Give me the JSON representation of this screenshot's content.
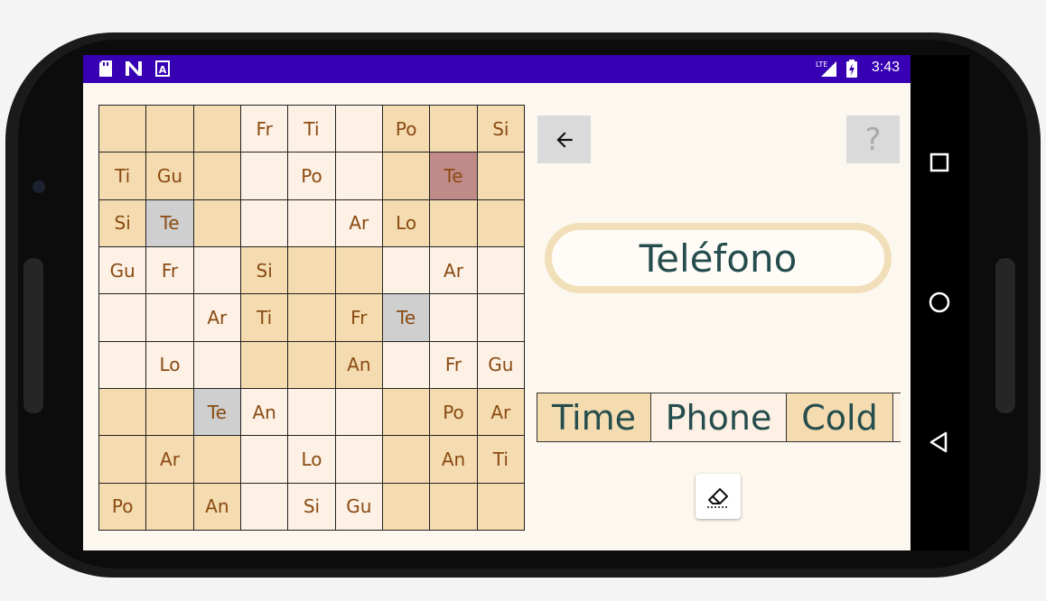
{
  "status_bar": {
    "time": "3:43",
    "network_label": "LTE",
    "left_icons": [
      "sd-card-icon",
      "n-icon",
      "a-icon"
    ],
    "bg_color": "#3700b3"
  },
  "grid": {
    "rows": [
      [
        {
          "t": "",
          "s": "dark"
        },
        {
          "t": "",
          "s": "dark"
        },
        {
          "t": "",
          "s": "dark"
        },
        {
          "t": "Fr",
          "s": "light"
        },
        {
          "t": "Ti",
          "s": "light"
        },
        {
          "t": "",
          "s": "light"
        },
        {
          "t": "Po",
          "s": "dark"
        },
        {
          "t": "",
          "s": "dark"
        },
        {
          "t": "Si",
          "s": "dark"
        }
      ],
      [
        {
          "t": "Ti",
          "s": "dark"
        },
        {
          "t": "Gu",
          "s": "dark"
        },
        {
          "t": "",
          "s": "dark"
        },
        {
          "t": "",
          "s": "light"
        },
        {
          "t": "Po",
          "s": "light"
        },
        {
          "t": "",
          "s": "light"
        },
        {
          "t": "",
          "s": "dark"
        },
        {
          "t": "Te",
          "s": "highlight"
        },
        {
          "t": "",
          "s": "dark"
        }
      ],
      [
        {
          "t": "Si",
          "s": "dark"
        },
        {
          "t": "Te",
          "s": "selected"
        },
        {
          "t": "",
          "s": "dark"
        },
        {
          "t": "",
          "s": "light"
        },
        {
          "t": "",
          "s": "light"
        },
        {
          "t": "Ar",
          "s": "light"
        },
        {
          "t": "Lo",
          "s": "dark"
        },
        {
          "t": "",
          "s": "dark"
        },
        {
          "t": "",
          "s": "dark"
        }
      ],
      [
        {
          "t": "Gu",
          "s": "light"
        },
        {
          "t": "Fr",
          "s": "light"
        },
        {
          "t": "",
          "s": "light"
        },
        {
          "t": "Si",
          "s": "dark"
        },
        {
          "t": "",
          "s": "dark"
        },
        {
          "t": "",
          "s": "dark"
        },
        {
          "t": "",
          "s": "light"
        },
        {
          "t": "Ar",
          "s": "light"
        },
        {
          "t": "",
          "s": "light"
        }
      ],
      [
        {
          "t": "",
          "s": "light"
        },
        {
          "t": "",
          "s": "light"
        },
        {
          "t": "Ar",
          "s": "light"
        },
        {
          "t": "Ti",
          "s": "dark"
        },
        {
          "t": "",
          "s": "dark"
        },
        {
          "t": "Fr",
          "s": "dark"
        },
        {
          "t": "Te",
          "s": "selected"
        },
        {
          "t": "",
          "s": "light"
        },
        {
          "t": "",
          "s": "light"
        }
      ],
      [
        {
          "t": "",
          "s": "light"
        },
        {
          "t": "Lo",
          "s": "light"
        },
        {
          "t": "",
          "s": "light"
        },
        {
          "t": "",
          "s": "dark"
        },
        {
          "t": "",
          "s": "dark"
        },
        {
          "t": "An",
          "s": "dark"
        },
        {
          "t": "",
          "s": "light"
        },
        {
          "t": "Fr",
          "s": "light"
        },
        {
          "t": "Gu",
          "s": "light"
        }
      ],
      [
        {
          "t": "",
          "s": "dark"
        },
        {
          "t": "",
          "s": "dark"
        },
        {
          "t": "Te",
          "s": "selected"
        },
        {
          "t": "An",
          "s": "light"
        },
        {
          "t": "",
          "s": "light"
        },
        {
          "t": "",
          "s": "light"
        },
        {
          "t": "",
          "s": "dark"
        },
        {
          "t": "Po",
          "s": "dark"
        },
        {
          "t": "Ar",
          "s": "dark"
        }
      ],
      [
        {
          "t": "",
          "s": "dark"
        },
        {
          "t": "Ar",
          "s": "dark"
        },
        {
          "t": "",
          "s": "dark"
        },
        {
          "t": "",
          "s": "light"
        },
        {
          "t": "Lo",
          "s": "light"
        },
        {
          "t": "",
          "s": "light"
        },
        {
          "t": "",
          "s": "dark"
        },
        {
          "t": "An",
          "s": "dark"
        },
        {
          "t": "Ti",
          "s": "dark"
        }
      ],
      [
        {
          "t": "Po",
          "s": "dark"
        },
        {
          "t": "",
          "s": "dark"
        },
        {
          "t": "An",
          "s": "dark"
        },
        {
          "t": "",
          "s": "light"
        },
        {
          "t": "Si",
          "s": "light"
        },
        {
          "t": "Gu",
          "s": "light"
        },
        {
          "t": "",
          "s": "dark"
        },
        {
          "t": "",
          "s": "dark"
        },
        {
          "t": "",
          "s": "dark"
        }
      ]
    ]
  },
  "controls": {
    "back_icon": "arrow-left-icon",
    "help_label": "?",
    "eraser_icon": "eraser-icon"
  },
  "word": {
    "current": "Teléfono"
  },
  "choices": [
    {
      "label": "Time",
      "style": "dark"
    },
    {
      "label": "Phone",
      "style": "light"
    },
    {
      "label": "Cold",
      "style": "dark"
    },
    {
      "label": "",
      "style": "light"
    }
  ],
  "colors": {
    "cell_dark": "#f4dbb0",
    "cell_light": "#fcf1e4",
    "cell_selected": "#cfcfcf",
    "cell_highlight": "#bf8a88",
    "cell_text": "#8a4a12",
    "word_text": "#264d4d"
  }
}
